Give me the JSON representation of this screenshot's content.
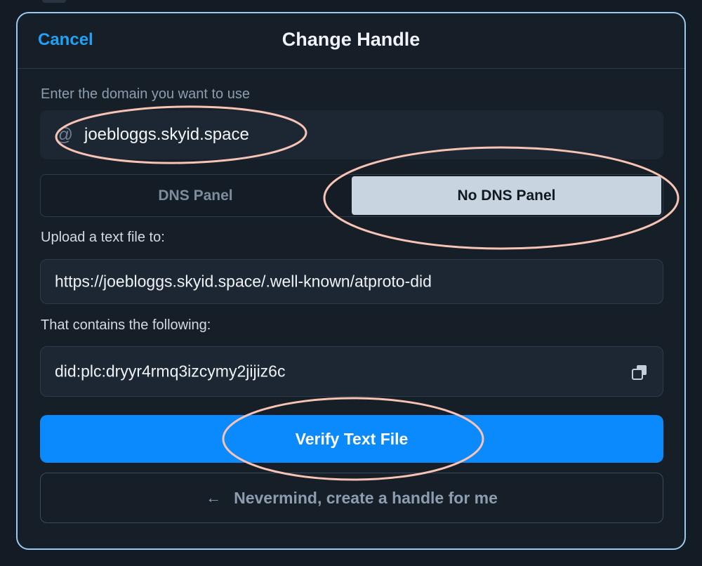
{
  "modal": {
    "cancel_label": "Cancel",
    "title": "Change Handle"
  },
  "domain": {
    "label": "Enter the domain you want to use",
    "value": "joebloggs.skyid.space",
    "icon": "at-icon"
  },
  "method_toggle": {
    "options": [
      "DNS Panel",
      "No DNS Panel"
    ],
    "selected": "No DNS Panel"
  },
  "upload": {
    "label": "Upload a text file to:",
    "url": "https://joebloggs.skyid.space/.well-known/atproto-did"
  },
  "contents": {
    "label": "That contains the following:",
    "did": "did:plc:dryyr4rmq3izcymy2jijiz6c",
    "copy_icon": "copy-icon"
  },
  "actions": {
    "verify_label": "Verify Text File",
    "nevermind_arrow": "←",
    "nevermind_label": "Nevermind, create a handle for me"
  },
  "colors": {
    "accent": "#0a8afd",
    "link": "#1ea1f7",
    "border": "#9cc9ef",
    "annotation": "#f7c3b4"
  }
}
